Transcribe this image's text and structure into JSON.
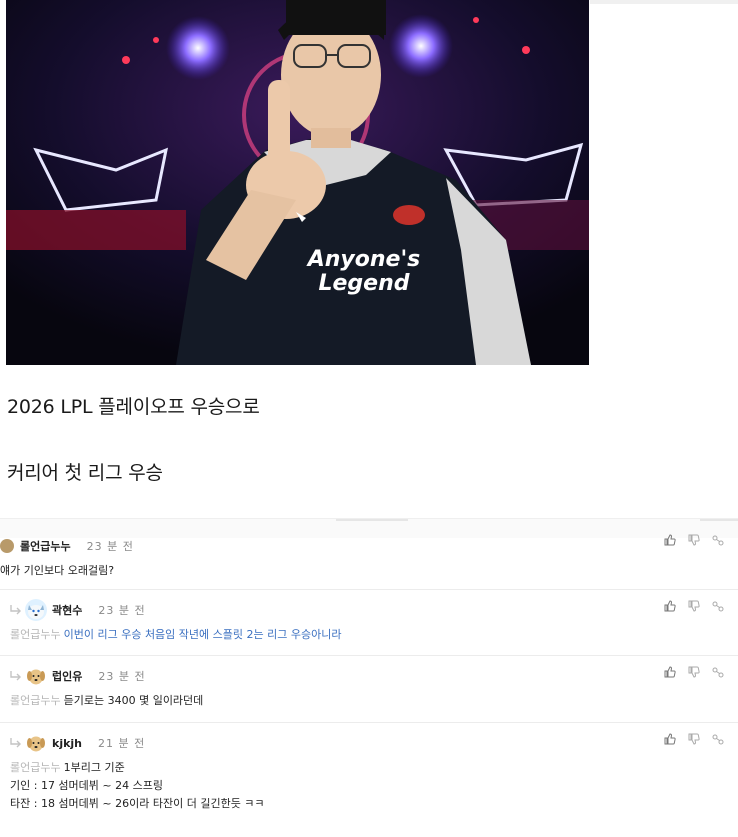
{
  "article": {
    "line1": "2026 LPL 플레이오프 우승으로",
    "line2": "커리어 첫 리그 우승",
    "photo_jersey_text_1": "Anyone's",
    "photo_jersey_text_2": "Legend"
  },
  "comments": [
    {
      "nickname": "롤언급누누",
      "time": "23 분 전",
      "body": "얘가 기인보다 오래걸림?",
      "avatar": "round-badge-icon"
    },
    {
      "nickname": "곽현수",
      "time": "23 분 전",
      "mention": "롤언급누누",
      "body": "이번이 리그 우승 처음임 작년에 스플릿 2는 리그 우승아니라",
      "avatar": "husky-dog-avatar"
    },
    {
      "nickname": "럽인유",
      "time": "23 분 전",
      "mention": "롤언급누누",
      "body": "듣기로는 3400 몇 일이라던데",
      "avatar": "golden-dog-avatar"
    },
    {
      "nickname": "kjkjh",
      "time": "21 분 전",
      "mention": "롤언급누누",
      "body_line1": "1부리그 기준",
      "body_line2": "기인 : 17 섬머데뷔 ~ 24 스프링",
      "body_line3": "타잔 : 18 섬머데뷔 ~ 26이라 타잔이 더 길긴한듯 ㅋㅋ",
      "avatar": "golden-dog-avatar"
    }
  ],
  "colors": {
    "mention_gray": "#b5b5b5",
    "reply_link_blue": "#3a6fc0",
    "time_gray": "#8a8a8a",
    "divider": "#ececec"
  },
  "icons": [
    "thumbs-up-icon",
    "thumbs-down-icon",
    "share-link-icon",
    "reply-arrow-icon"
  ]
}
